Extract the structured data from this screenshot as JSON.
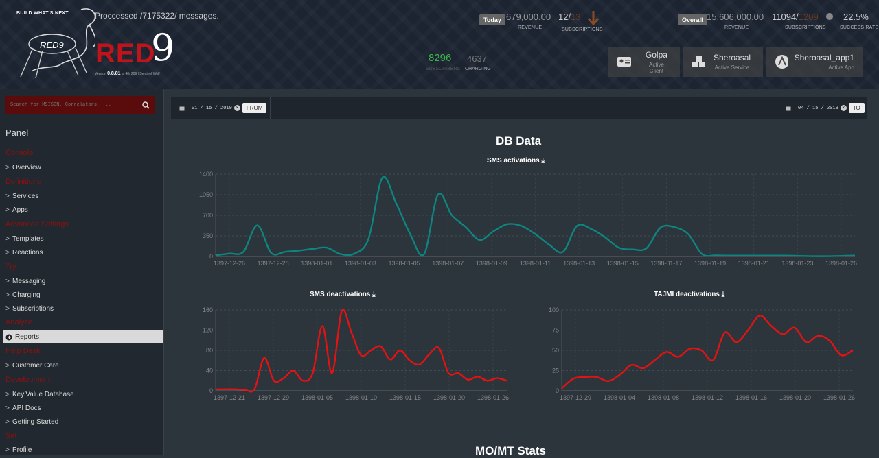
{
  "header": {
    "tagline": "BUILD WHAT'S NEXT",
    "processed": "Proccessed /7175322/ messages.",
    "brand_letters": "RED",
    "brand_nine": "9",
    "logo_script": "RED9",
    "version_label": "Version",
    "version": "0.8.81",
    "version_suffix": "at 4th 209 | Sentinel Wolf",
    "today": {
      "badge": "Today",
      "revenue": "679,000.00",
      "revenue_label": "REVENUE",
      "subs": "12/",
      "subs_dim": "13",
      "subs_label": "SUBSCRIPTIONS"
    },
    "overall": {
      "badge": "Overall",
      "revenue": "15,606,000.00",
      "revenue_label": "REVENUE",
      "subs": "11094/",
      "subs_dim": "1209",
      "subs_label": "SUBSCRIPTIONS",
      "rate": "22.5%",
      "rate_label": "SUCCESS RATE"
    },
    "subscribers": "8296",
    "subscribers_label": "SUBSCRIBERS",
    "charging": "4637",
    "charging_label": "CHARGING",
    "cards": [
      {
        "title": "Golpa",
        "sub": "Active Client"
      },
      {
        "title": "Sheroasal",
        "sub": "Active Service"
      },
      {
        "title": "Sheroasal_app1",
        "sub": "Active App"
      }
    ]
  },
  "search": {
    "placeholder": "Search for MSISDN, Correlators, ..."
  },
  "sidebar": {
    "panel_title": "Panel",
    "sections": {
      "console": "Console",
      "definitions": "Definitions",
      "advanced": "Advanced Settings",
      "try": "Try",
      "analyze": "Analyze",
      "helpdesk": "Help Desk",
      "development": "Development",
      "set": "Set"
    },
    "items": {
      "overview": "Overview",
      "services": "Services",
      "apps": "Apps",
      "templates": "Templates",
      "reactions": "Reactions",
      "messaging": "Messaging",
      "charging": "Charging",
      "subscriptions": "Subscriptions",
      "reports": "Reports",
      "customer_care": "Customer Care",
      "kv": "Key.Value Database",
      "api": "API Docs",
      "getting_started": "Getting Started",
      "profile": "Profile"
    }
  },
  "datebar": {
    "from_date": "01 / 15 / 2019",
    "from_btn": "FROM",
    "to_date": "04 / 15 / 2019",
    "to_btn": "TO"
  },
  "main": {
    "title": "DB Data",
    "next_section": "MO/MT Stats"
  },
  "colors": {
    "teal": "#0e8580",
    "red": "#e31313",
    "accent_red": "#8b1111",
    "green": "#3bb54a"
  },
  "chart_data": [
    {
      "type": "line",
      "title": "SMS activations",
      "ylim": [
        0,
        1400
      ],
      "yticks": [
        0,
        350,
        700,
        1050,
        1400
      ],
      "xticklabels": [
        "1397-12-26",
        "1397-12-28",
        "1398-01-01",
        "1398-01-03",
        "1398-01-05",
        "1398-01-07",
        "1398-01-09",
        "1398-01-11",
        "1398-01-13",
        "1398-01-15",
        "1398-01-17",
        "1398-01-19",
        "1398-01-21",
        "1398-01-23",
        "1398-01-26"
      ],
      "values": [
        20,
        50,
        80,
        530,
        60,
        80,
        100,
        130,
        150,
        40,
        50,
        300,
        1340,
        900,
        380,
        40,
        1050,
        700,
        500,
        280,
        430,
        550,
        520,
        380,
        200,
        80,
        520,
        470,
        330,
        150,
        120,
        140,
        490,
        500,
        380,
        40,
        20,
        15,
        15,
        15,
        15,
        15,
        10,
        5,
        5,
        10,
        15
      ],
      "grid": true
    },
    {
      "type": "line",
      "title": "SMS deactivations",
      "ylim": [
        0,
        160
      ],
      "yticks": [
        0,
        40,
        80,
        120,
        160
      ],
      "xticklabels": [
        "1397-12-21",
        "1397-12-29",
        "1398-01-05",
        "1398-01-10",
        "1398-01-15",
        "1398-01-20",
        "1398-01-26"
      ],
      "values": [
        3,
        3,
        3,
        2,
        3,
        65,
        20,
        25,
        40,
        20,
        35,
        128,
        35,
        158,
        115,
        70,
        80,
        88,
        62,
        80,
        60,
        52,
        72,
        85,
        35,
        35,
        22,
        28,
        20,
        25,
        20
      ],
      "grid": true
    },
    {
      "type": "line",
      "title": "TAJMI deactivations",
      "ylim": [
        0,
        100
      ],
      "yticks": [
        0,
        25,
        50,
        75,
        100
      ],
      "xticklabels": [
        "1397-12-29",
        "1398-01-04",
        "1398-01-08",
        "1398-01-12",
        "1398-01-16",
        "1398-01-20",
        "1398-01-26"
      ],
      "values": [
        3,
        15,
        17,
        17,
        12,
        20,
        32,
        28,
        38,
        48,
        42,
        52,
        50,
        38,
        72,
        60,
        75,
        93,
        80,
        70,
        78,
        60,
        68,
        62,
        44,
        50
      ],
      "grid": true
    }
  ]
}
